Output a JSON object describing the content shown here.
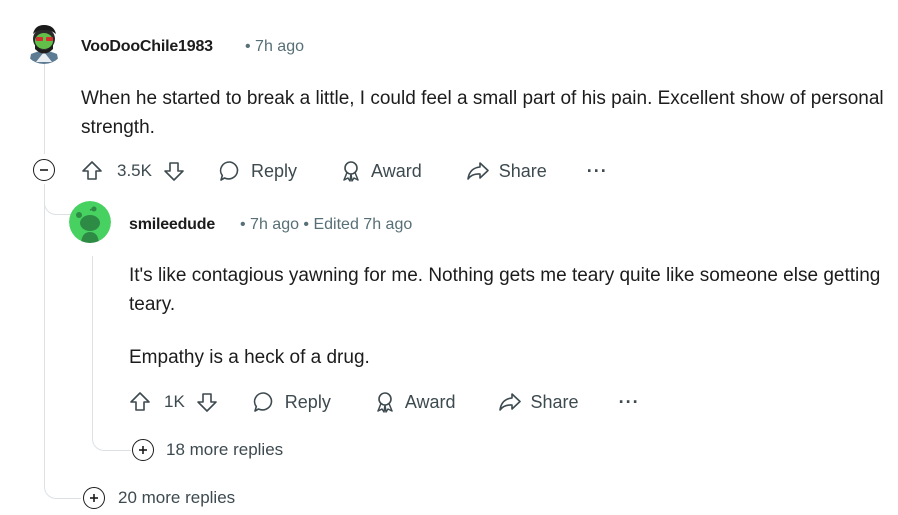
{
  "comment1": {
    "username": "VooDooChile1983",
    "time": "7h ago",
    "body": "When he started to break a little, I could feel a small part of his pain. Excellent show of personal strength.",
    "actions": {
      "votes": "3.5K",
      "reply": "Reply",
      "award": "Award",
      "share": "Share",
      "more": "···"
    }
  },
  "reply1": {
    "username": "smileedude",
    "time": "7h ago",
    "edited": "Edited 7h ago",
    "body_p1": "It's like contagious yawning for me. Nothing gets me teary quite like someone else getting teary.",
    "body_p2": "Empathy is a heck of a drug.",
    "actions": {
      "votes": "1K",
      "reply": "Reply",
      "award": "Award",
      "share": "Share",
      "more": "···"
    },
    "more_replies": "18 more replies"
  },
  "thread": {
    "more_replies": "20 more replies"
  },
  "colors": {
    "avatar_snoo": "#46d160",
    "avatar_dark": "#1a2833",
    "meta_text": "#576f76",
    "thread_line": "#dde1e4"
  }
}
